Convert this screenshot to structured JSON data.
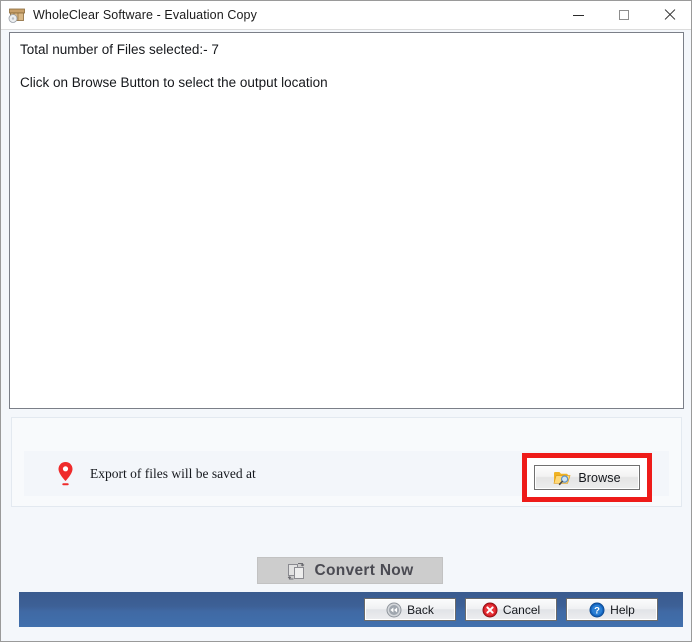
{
  "window": {
    "title": "WholeClear Software - Evaluation Copy",
    "app_icon": "archive-disc-icon",
    "controls": {
      "minimize": "minimize-icon",
      "maximize": "maximize-icon",
      "close": "close-icon"
    }
  },
  "file_list": {
    "lines": [
      "Total number of Files selected:-  7",
      "Click on Browse Button to select the output location"
    ]
  },
  "export_panel": {
    "pin_icon": "location-pin-icon",
    "label": "Export of files will be saved at",
    "browse": {
      "label": "Browse",
      "icon": "folder-search-icon",
      "highlight_color": "#ee1b19"
    }
  },
  "convert": {
    "label": "Convert Now",
    "icon": "convert-pages-icon",
    "enabled": false
  },
  "bottom_bar": {
    "background_color": "#3f66a0",
    "buttons": [
      {
        "label": "Back",
        "icon": "rewind-icon"
      },
      {
        "label": "Cancel",
        "icon": "cancel-x-icon"
      },
      {
        "label": "Help",
        "icon": "question-mark-icon"
      }
    ]
  }
}
